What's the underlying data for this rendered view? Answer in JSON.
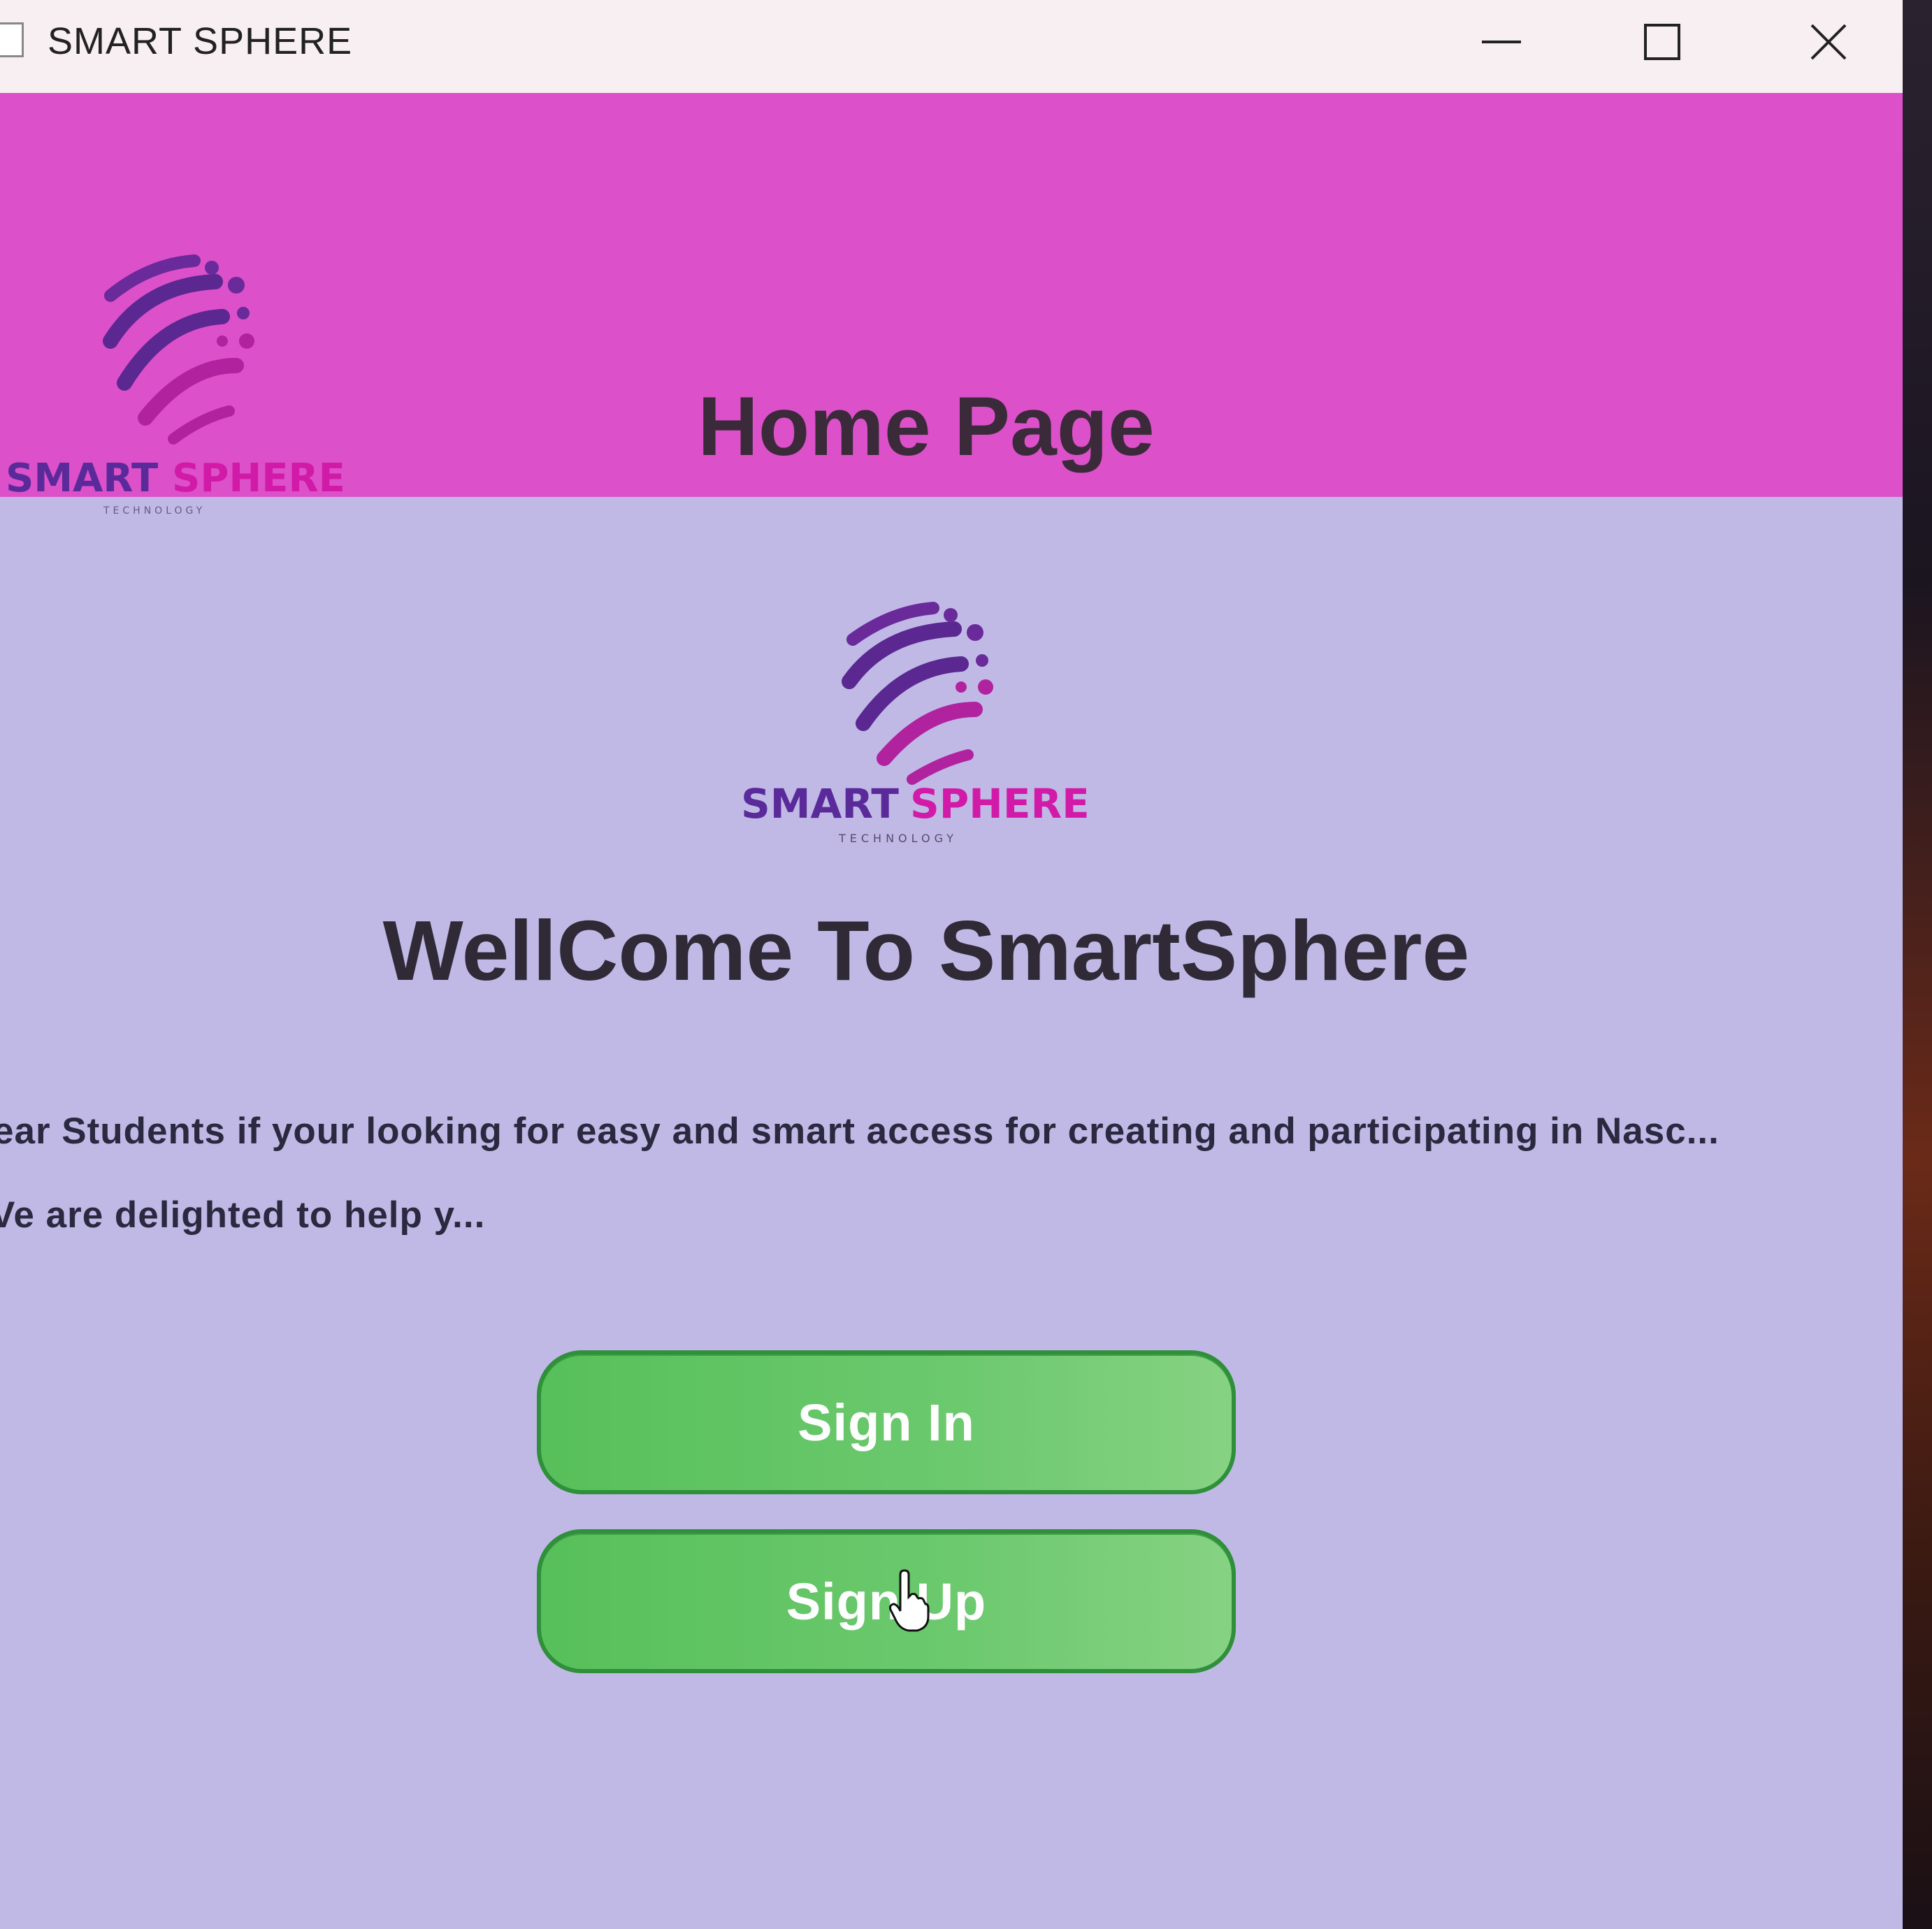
{
  "window": {
    "title": "SMART SPHERE",
    "controls": {
      "minimize": "minimize-icon",
      "maximize": "maximize-icon",
      "close": "close-icon"
    }
  },
  "header": {
    "logo": {
      "name_part1": "SMART",
      "name_part2": "SPHERE",
      "tagline": "TECHNOLOGY"
    },
    "title": "Home Page"
  },
  "main": {
    "logo": {
      "name_part1": "SMART",
      "name_part2": "SPHERE",
      "tagline": "TECHNOLOGY"
    },
    "welcome": "WellCome To SmartSphere",
    "description_line1": "ear Students if your looking for easy and smart access for creating and participating in Nasc...",
    "description_line2": "Ve are delighted to help y...",
    "buttons": {
      "sign_in": "Sign In",
      "sign_up": "Sign Up"
    }
  },
  "colors": {
    "header_bg": "#dc50c9",
    "body_bg": "#c0b9e6",
    "button_green": "#5cc25e",
    "logo_purple": "#5a2a9a",
    "logo_magenta": "#d21aa8"
  }
}
